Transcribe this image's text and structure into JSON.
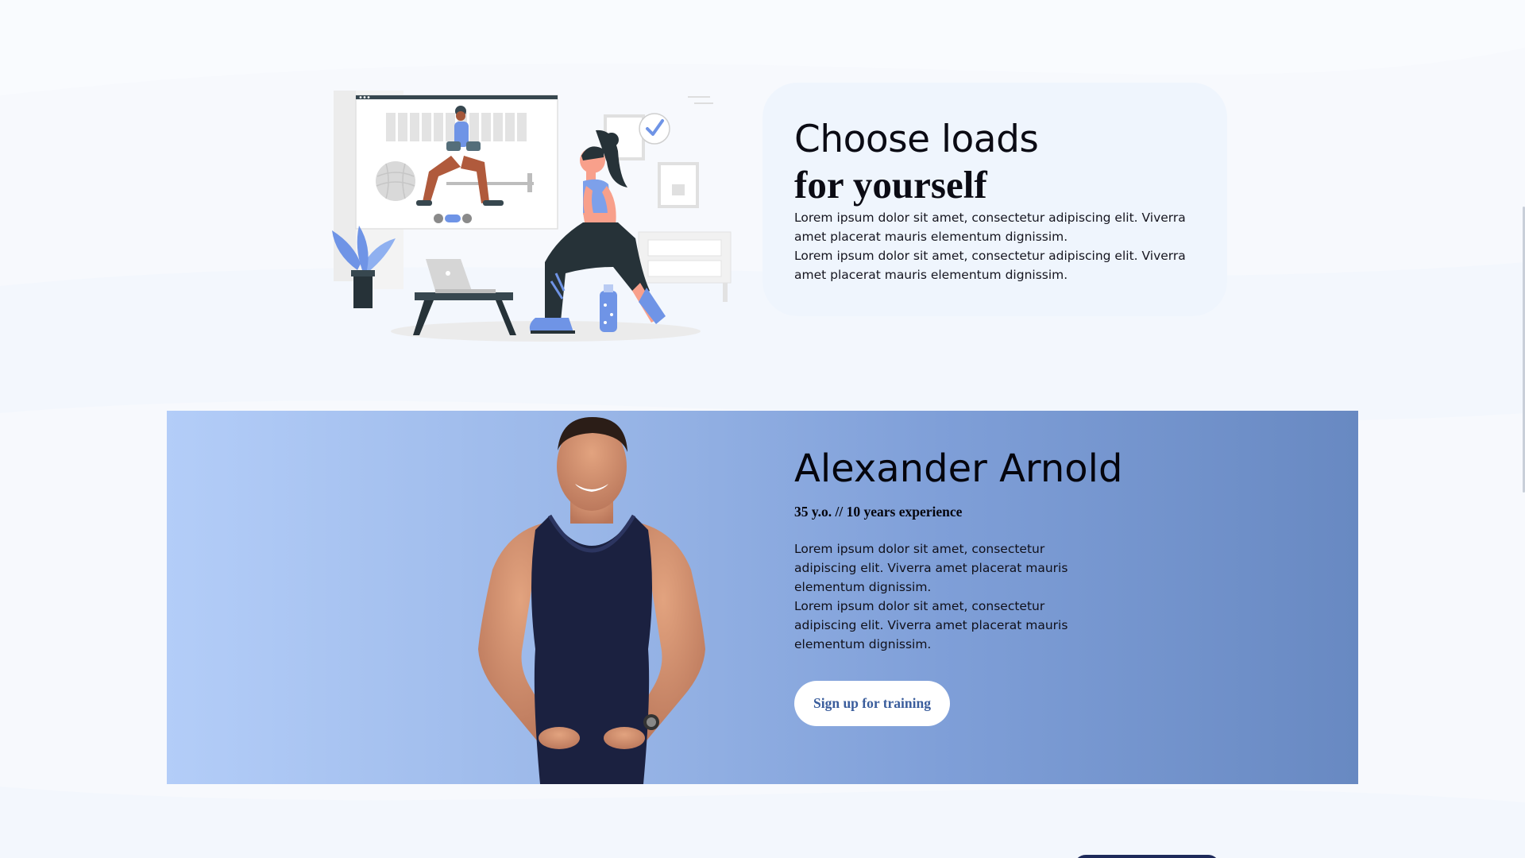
{
  "section_loads": {
    "heading_line1": "Choose loads",
    "heading_line2": "for yourself",
    "paragraph1": "Lorem ipsum dolor sit amet, consectetur adipiscing elit. Viverra amet placerat mauris elementum dignissim.",
    "paragraph2": "Lorem ipsum dolor sit amet, consectetur adipiscing elit. Viverra amet placerat mauris elementum dignissim."
  },
  "trainer": {
    "name": "Alexander Arnold",
    "meta": "35 y.o. // 10 years experience",
    "paragraph1": "Lorem ipsum dolor sit amet, consectetur adipiscing elit. Viverra amet placerat mauris elementum dignissim.",
    "paragraph2": "Lorem ipsum dolor sit amet, consectetur adipiscing elit. Viverra amet placerat mauris elementum dignissim.",
    "button_label": "Sign up for training"
  },
  "colors": {
    "page_bg": "#f7f9fd",
    "card_bg": "#eff5fd",
    "band_gradient_start": "#b3cdf8",
    "band_gradient_end": "#6889c2",
    "accent": "#6f94e6",
    "button_text": "#3a5d9c"
  },
  "icons": {
    "checkmark": "check-icon",
    "video_call_controls": [
      "mute-icon",
      "hangup-icon",
      "mic-icon"
    ]
  }
}
